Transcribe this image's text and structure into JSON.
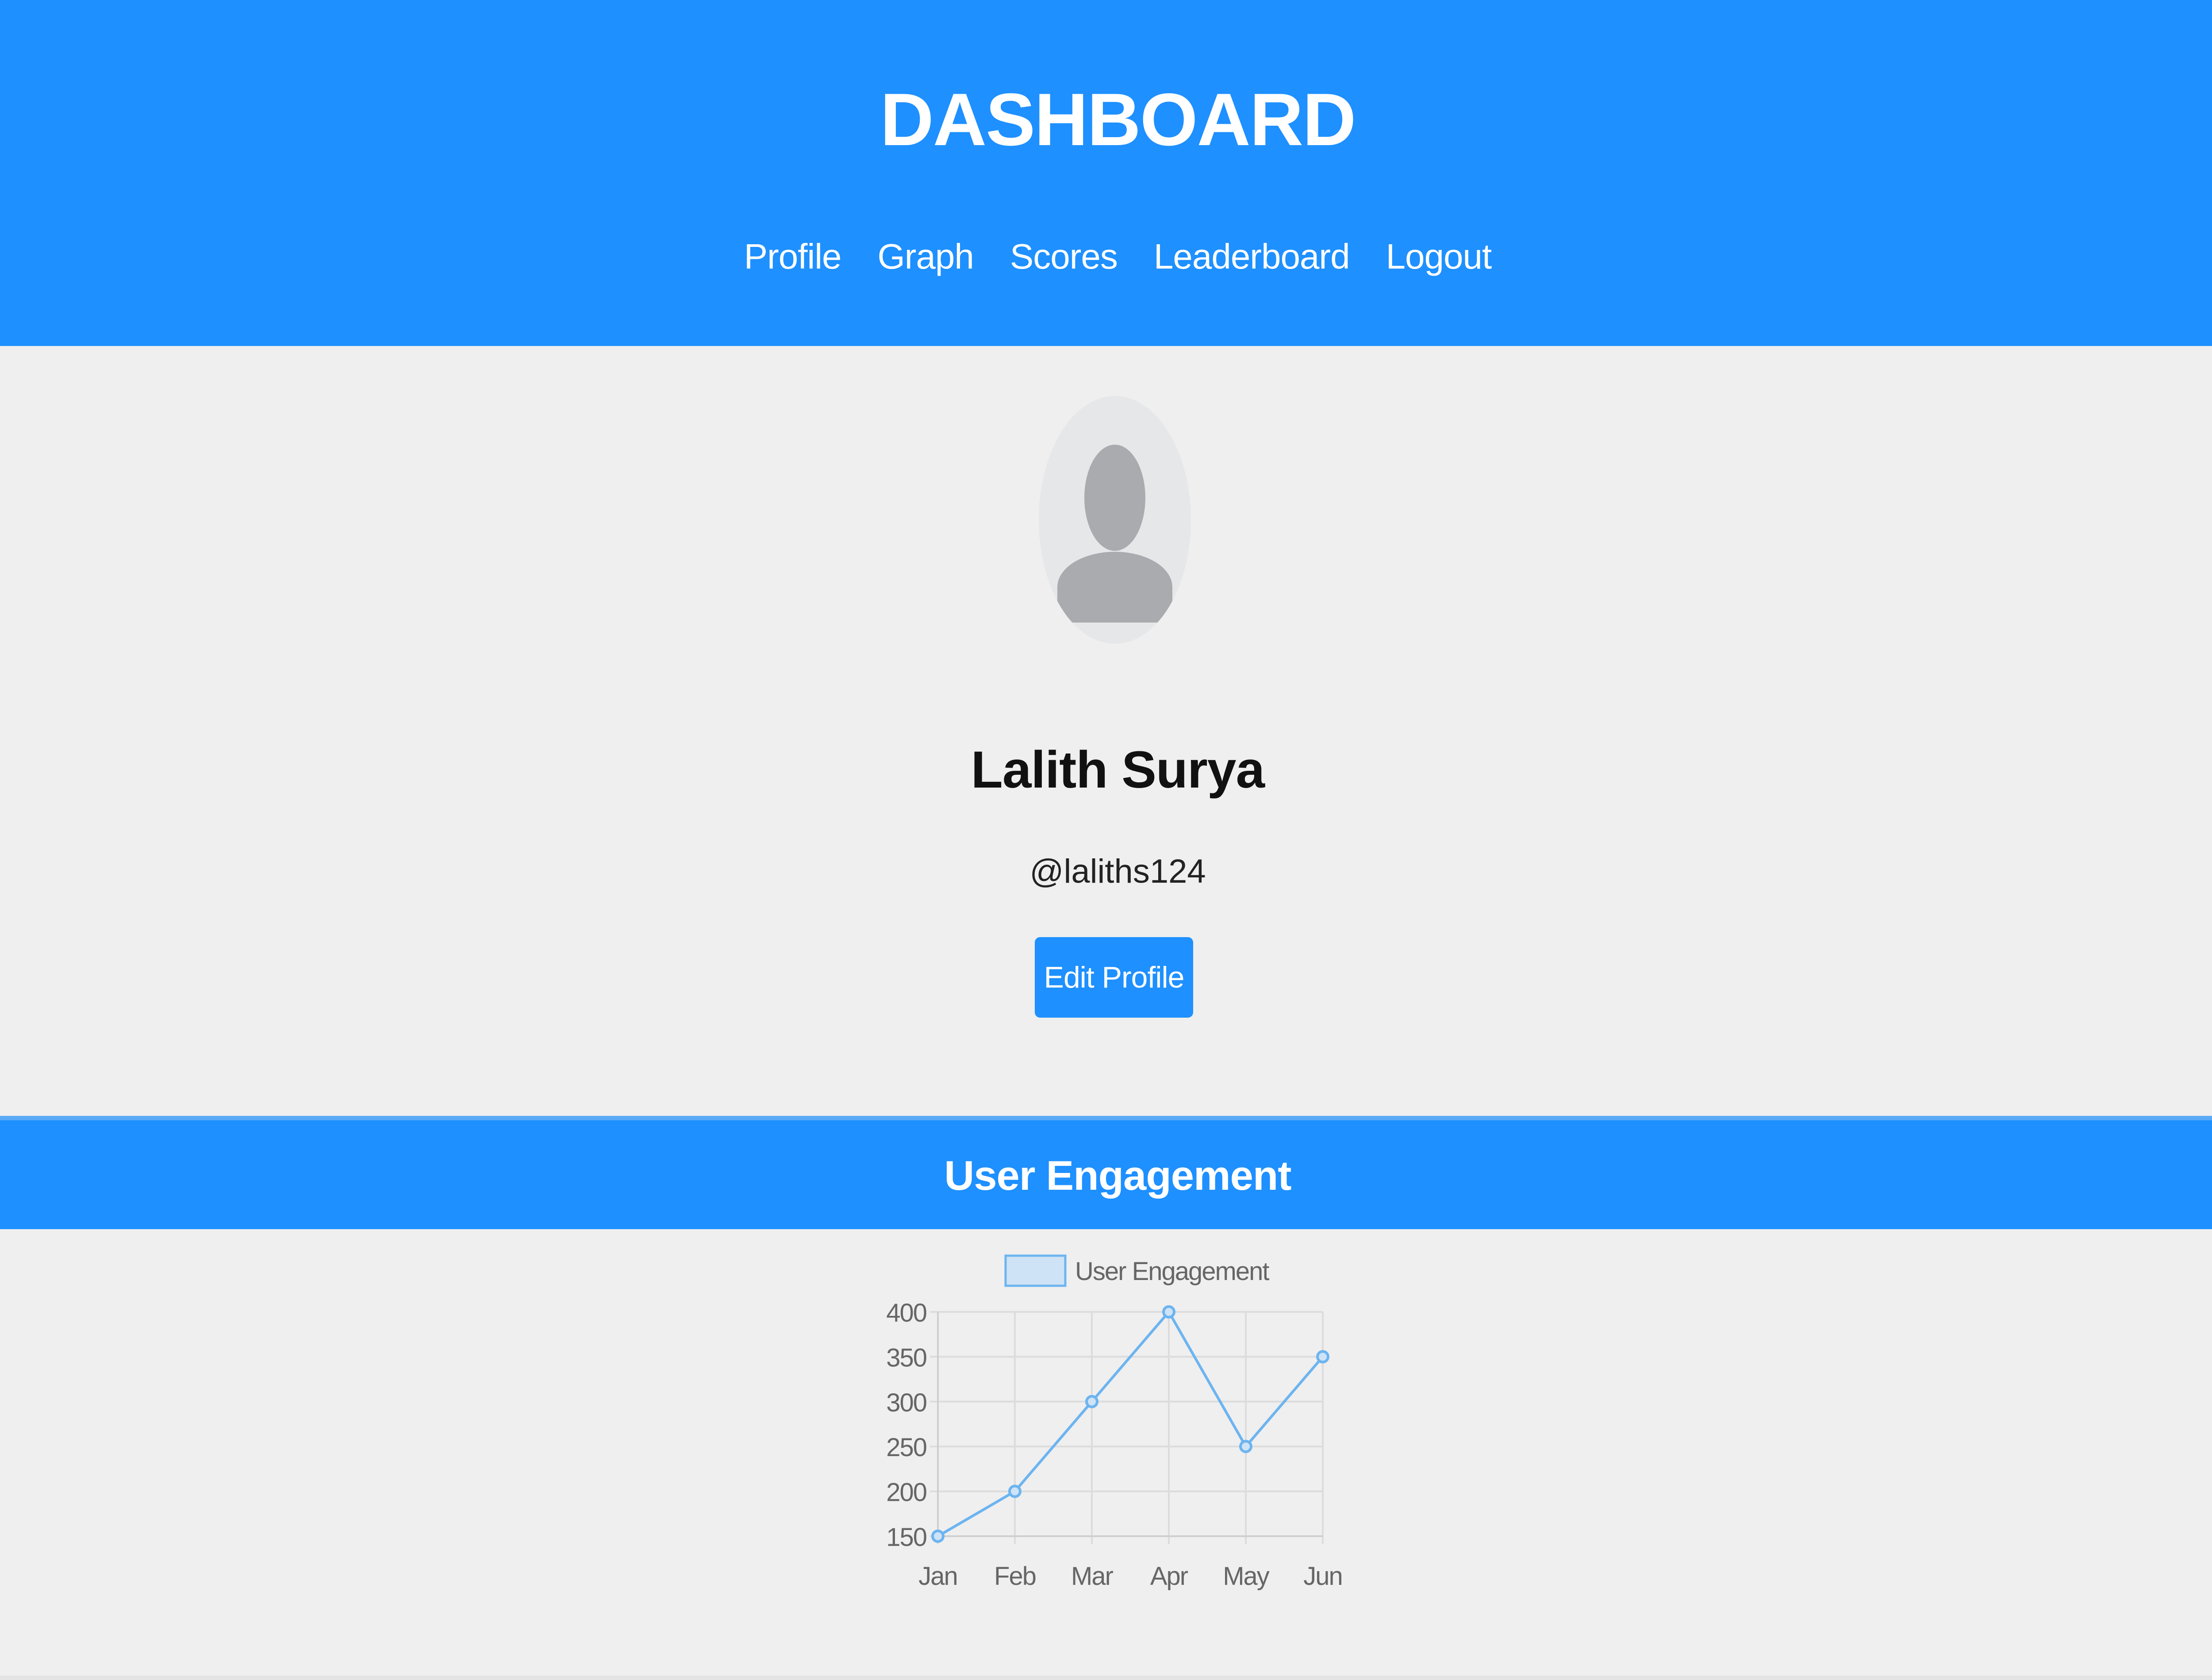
{
  "header": {
    "title": "DASHBOARD",
    "nav": [
      {
        "label": "Profile"
      },
      {
        "label": "Graph"
      },
      {
        "label": "Scores"
      },
      {
        "label": "Leaderboard"
      },
      {
        "label": "Logout"
      }
    ]
  },
  "profile": {
    "avatar_icon": "user-placeholder-icon",
    "name": "Lalith Surya",
    "handle": "@laliths124",
    "edit_button_label": "Edit Profile"
  },
  "engagement": {
    "section_title": "User Engagement"
  },
  "colors": {
    "primary": "#1e90ff",
    "background": "#efefef",
    "line": "#6cb4f0",
    "legend_fill": "#cfe3f6"
  },
  "chart_data": {
    "type": "line",
    "x": [
      "Jan",
      "Feb",
      "Mar",
      "Apr",
      "May",
      "Jun"
    ],
    "series": [
      {
        "name": "User Engagement",
        "values": [
          150,
          200,
          300,
          400,
          250,
          350
        ]
      }
    ],
    "ylim": [
      150,
      400
    ],
    "yticks": [
      150,
      200,
      250,
      300,
      350,
      400
    ],
    "grid": true,
    "legend": "top-center"
  }
}
